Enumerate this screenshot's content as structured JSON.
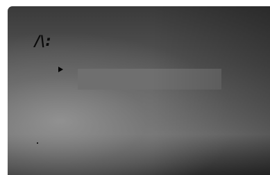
{
  "screen": {
    "logo_text": "/\\:",
    "menu": {
      "selected_item": ""
    },
    "colors": {
      "panel_top": "#3a3a3a",
      "panel_mid": "#7a7a7a",
      "panel_bottom": "#2f2f2f",
      "highlight_bar": "#6f6f6f",
      "pointer": "#000000"
    },
    "icons": {
      "pointer": "triangle-right-icon"
    }
  }
}
